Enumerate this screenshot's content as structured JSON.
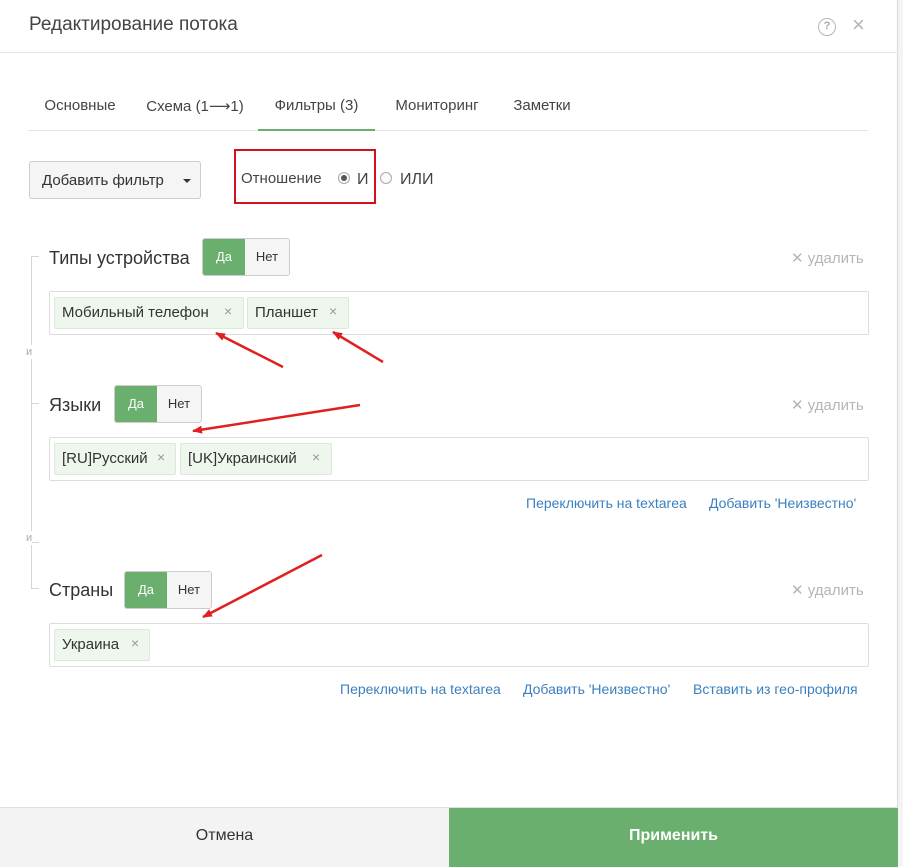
{
  "header": {
    "title": "Редактирование потока",
    "help_icon_glyph": "?",
    "close_icon_glyph": "×"
  },
  "tabs": [
    {
      "label": "Основные",
      "active": false
    },
    {
      "label": "Схема (1⟶1)",
      "active": false
    },
    {
      "label": "Фильтры (3)",
      "active": true
    },
    {
      "label": "Мониторинг",
      "active": false
    },
    {
      "label": "Заметки",
      "active": false
    }
  ],
  "toolbar": {
    "add_filter_label": "Добавить фильтр",
    "relation_label": "Отношение",
    "relation_options": [
      {
        "label": "И",
        "checked": true
      },
      {
        "label": "ИЛИ",
        "checked": false
      }
    ]
  },
  "connector_label": "и",
  "filters": [
    {
      "title": "Типы устройства",
      "yes_label": "Да",
      "no_label": "Нет",
      "selected": "Да",
      "remove_label": "✕ удалить",
      "tags": [
        "Мобильный телефон",
        "Планшет"
      ],
      "links": []
    },
    {
      "title": "Языки",
      "yes_label": "Да",
      "no_label": "Нет",
      "selected": "Да",
      "remove_label": "✕ удалить",
      "tags": [
        "[RU]Русский",
        "[UK]Украинский"
      ],
      "links": [
        "Переключить на textarea",
        "Добавить 'Неизвестно'"
      ]
    },
    {
      "title": "Страны",
      "yes_label": "Да",
      "no_label": "Нет",
      "selected": "Да",
      "remove_label": "✕ удалить",
      "tags": [
        "Украина"
      ],
      "links": [
        "Переключить на textarea",
        "Добавить 'Неизвестно'",
        "Вставить из гео-профиля"
      ]
    }
  ],
  "tag_remove_glyph": "×",
  "footer": {
    "cancel_label": "Отмена",
    "apply_label": "Применить"
  },
  "colors": {
    "accent_green": "#6aaf6e",
    "highlight_red": "#d0111b",
    "link_blue": "#3b80c0"
  }
}
